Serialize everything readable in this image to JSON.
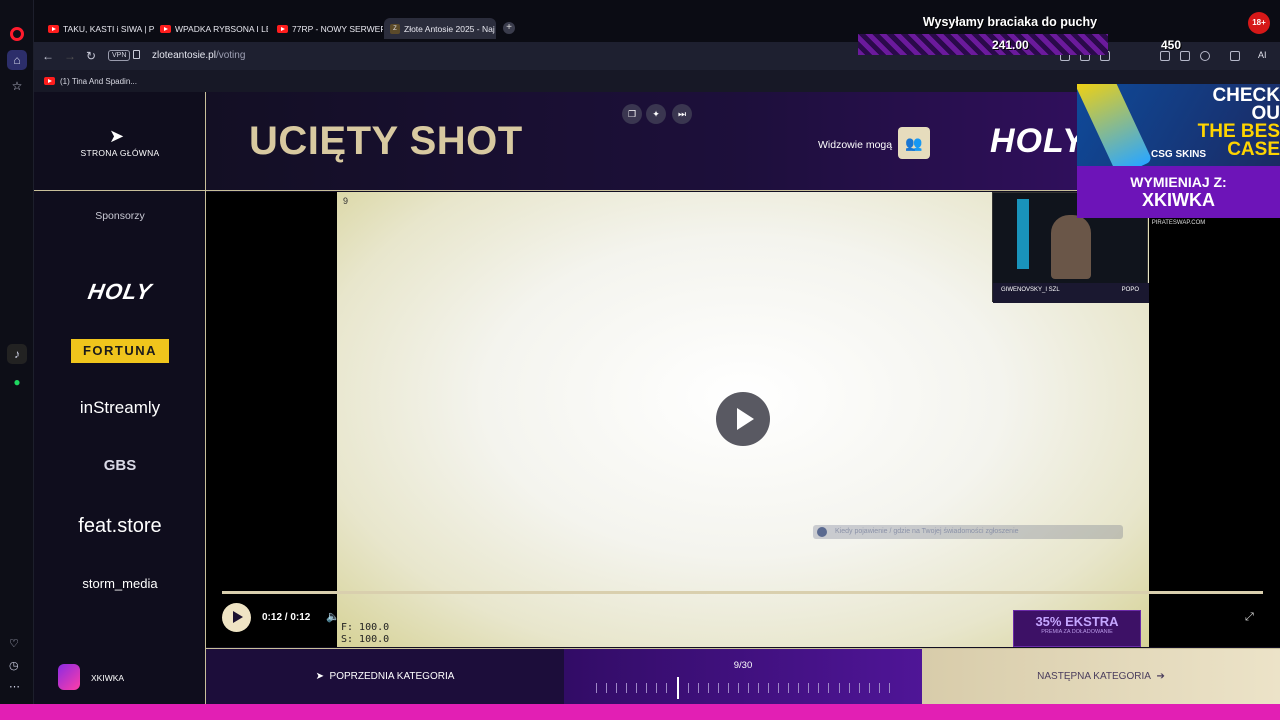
{
  "browser": {
    "tabs": [
      {
        "label": "TAKU, KASTI i SIWA | PATR"
      },
      {
        "label": "WPADKA RYBSONA I LEG"
      },
      {
        "label": "77RP - NOWY SERWER W"
      },
      {
        "label": "Złote Antosie 2025 - Naj"
      }
    ],
    "new_tab": "+",
    "vpn_label": "VPN",
    "url_host": "zloteantosie.pl",
    "url_path": "/voting",
    "bookmark_label": "(1) Tina And Spadin..."
  },
  "sidebar": {
    "home_label": "STRONA GŁÓWNA",
    "sponsors_title": "Sponsorzy",
    "sponsors": [
      "HOLY",
      "FORTUNA",
      "inStreamly",
      "GBS",
      "feat.store",
      "storm_media"
    ],
    "user_name": "XKIWKA"
  },
  "header": {
    "category_title": "UCIĘTY SHOT",
    "viewers_label": "Widzowie mogą",
    "brand": "HOLY"
  },
  "player": {
    "time": "0:12 / 0:12",
    "cam_name": "GIWENOVSKY_I SZL",
    "cam_right": "POPO",
    "subtitle_note": "Kiedy pojawienie / gdzie na Twojej świadomości zgłoszenie",
    "ekstra_title": "35% EKSTRA",
    "ekstra_sub": "PREMIA ZA DOŁADOWANIE",
    "fs_line1": "F: 100.0",
    "fs_line2": "S: 100.0",
    "corner_label": "9"
  },
  "footer": {
    "prev": "POPRZEDNIA KATEGORIA",
    "counter": "9/30",
    "next": "NASTĘPNA KATEGORIA"
  },
  "overlay": {
    "title": "Wysyłamy braciaka do puchy",
    "amount": "241.00",
    "goal": "450",
    "age": "18+",
    "ad_line1": "CHECK OU",
    "ad_line2": "THE BES",
    "ad_line3": "CASE",
    "ad_brand": "CSG SKINS",
    "ad2_line1": "WYMIENIAJ Z:",
    "ad2_line2": "XKIWKA",
    "ad2_site": "PIRATESWAP.COM"
  },
  "ai_label": "AI",
  "counter_progress": {
    "current": 9,
    "total": 30
  }
}
